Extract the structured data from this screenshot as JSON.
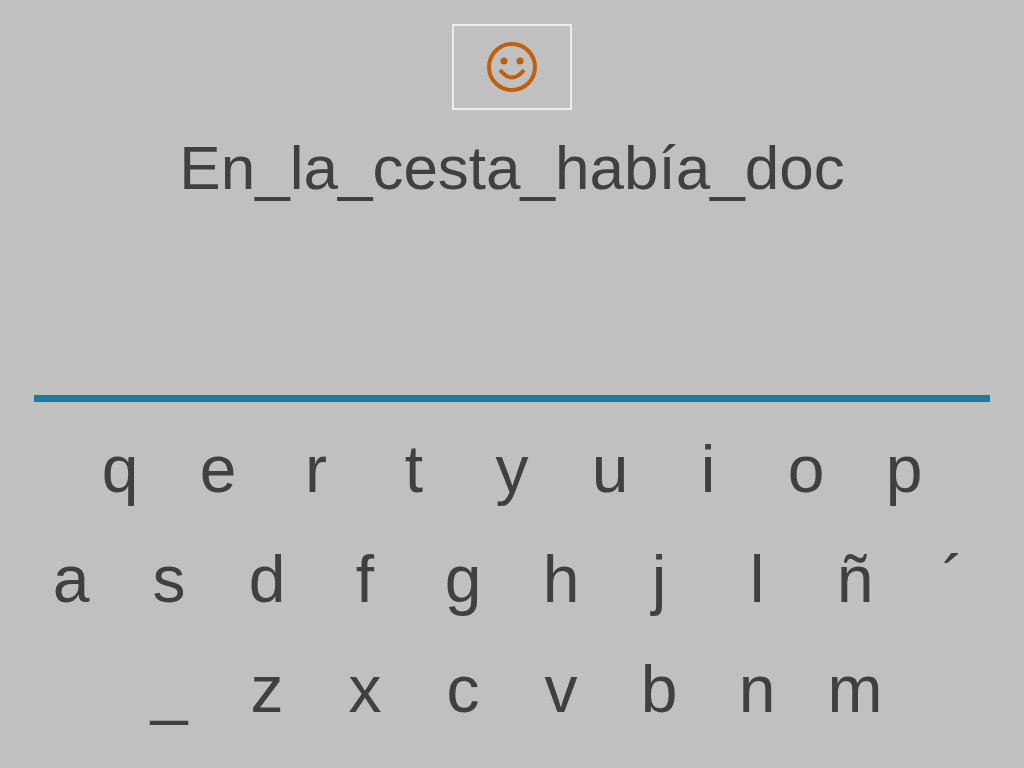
{
  "answer": "En_la_cesta_había_doc",
  "keyboard": [
    [
      "q",
      "e",
      "r",
      "t",
      "y",
      "u",
      "i",
      "o",
      "p"
    ],
    [
      "a",
      "s",
      "d",
      "f",
      "g",
      "h",
      "j",
      "l",
      "ñ",
      "´"
    ],
    [
      "_",
      "z",
      "x",
      "c",
      "v",
      "b",
      "n",
      "m"
    ]
  ]
}
